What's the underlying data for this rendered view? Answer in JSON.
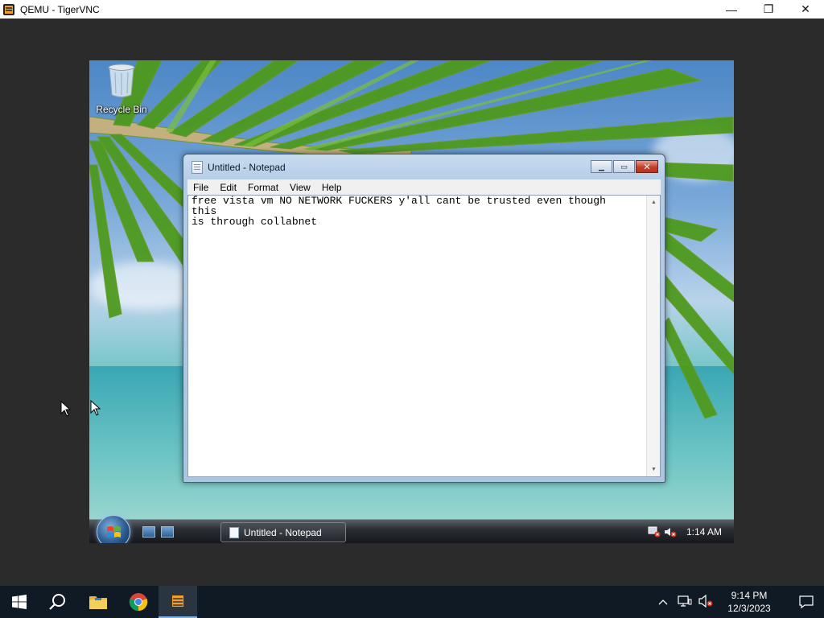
{
  "host_window": {
    "title": "QEMU - TigerVNC",
    "controls": {
      "minimize": "—",
      "restore": "❐",
      "close": "✕"
    }
  },
  "guest": {
    "desktop_icons": [
      {
        "label": "Recycle Bin",
        "icon": "recycle-bin-icon"
      }
    ],
    "notepad": {
      "title": "Untitled - Notepad",
      "menu": [
        "File",
        "Edit",
        "Format",
        "View",
        "Help"
      ],
      "content": "free vista vm NO NETWORK FUCKERS y'all cant be trusted even though\nthis\nis through collabnet"
    },
    "taskbar": {
      "start_icon": "windows-orb-icon",
      "quick_launch": [
        "show-desktop-icon",
        "switch-windows-icon"
      ],
      "task_button_label": "Untitled - Notepad",
      "tray_icons": [
        "network-disconnected-icon",
        "volume-muted-icon"
      ],
      "clock": "1:14 AM"
    }
  },
  "host_taskbar": {
    "apps": [
      "windows-start-icon",
      "search-icon",
      "file-explorer-icon",
      "chrome-icon",
      "tigervnc-icon"
    ],
    "tray_icons": [
      "chevron-up-icon",
      "network-icon",
      "volume-muted-icon"
    ],
    "time": "9:14 PM",
    "date": "12/3/2023",
    "notifications_icon": "notification-icon"
  },
  "colors": {
    "vista_accent": "#b4cde6",
    "host_taskbar": "#0f1a24",
    "close_red": "#c2402a"
  }
}
